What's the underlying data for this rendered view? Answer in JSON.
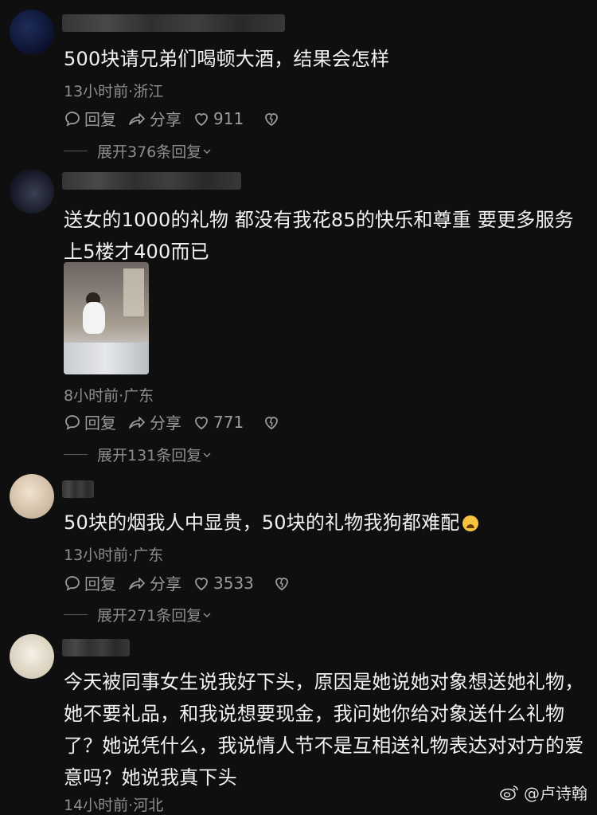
{
  "comments": [
    {
      "text": "500块请兄弟们喝顿大酒，结果会怎样",
      "meta": "13小时前·浙江",
      "reply_label": "回复",
      "share_label": "分享",
      "likes": "911",
      "expand": "展开376条回复"
    },
    {
      "text": "送女的1000的礼物 都没有我花85的快乐和尊重 要更多服务上5楼才400而已",
      "meta": "8小时前·广东",
      "reply_label": "回复",
      "share_label": "分享",
      "likes": "771",
      "expand": "展开131条回复"
    },
    {
      "text": "50块的烟我人中显贵，50块的礼物我狗都难配",
      "meta": "13小时前·广东",
      "reply_label": "回复",
      "share_label": "分享",
      "likes": "3533",
      "expand": "展开271条回复"
    },
    {
      "text": "今天被同事女生说我好下头，原因是她说她对象想送她礼物，她不要礼品，和我说想要现金，我问她你给对象送什么礼物了？她说凭什么，我说情人节不是互相送礼物表达对对方的爱意吗？她说我真下头",
      "meta": "14小时前·河北"
    }
  ],
  "watermark": "@卢诗翰",
  "icons": {
    "reply": "chat-bubble-icon",
    "share": "share-arrow-icon",
    "like": "heart-icon",
    "dislike": "broken-heart-icon",
    "expand": "chevron-down-icon",
    "watermark": "weibo-logo-icon"
  }
}
